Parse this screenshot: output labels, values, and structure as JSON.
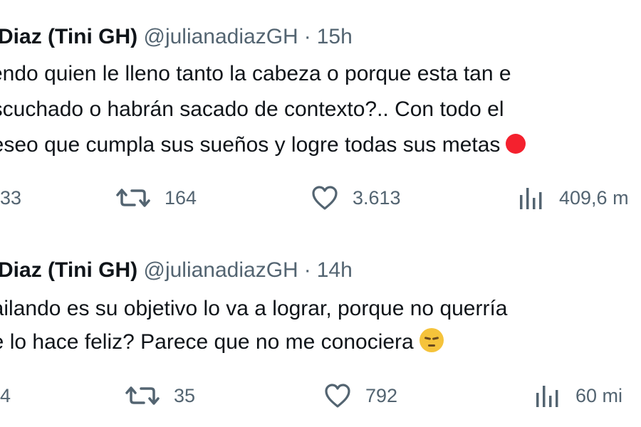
{
  "tweets": [
    {
      "name": "a Diaz (Tini GH)",
      "handle": "@julianadiazGH",
      "separator": "·",
      "time": "15h",
      "lines": [
        "tiendo quien le lleno tanto la cabeza o porque esta tan e",
        "escuchado o habrán sacado de contexto?.. Con todo el",
        "deseo que cumpla sus sueños y logre todas sus metas"
      ],
      "emoji": "red-heart-icon",
      "replies": "33",
      "retweets": "164",
      "likes": "3.613",
      "views": "409,6 m"
    },
    {
      "name": "a Diaz (Tini GH)",
      "handle": "@julianadiazGH",
      "separator": "·",
      "time": "14h",
      "lines": [
        "bailando es su objetivo lo va a lograr, porque no querría",
        "ue lo hace feliz? Parece que no me conociera"
      ],
      "emoji": "pensive-face-icon",
      "replies": "4",
      "retweets": "35",
      "likes": "792",
      "views": "60 mi"
    }
  ],
  "colors": {
    "text": "#0f1419",
    "secondary": "#536471",
    "emoji_yellow": "#f5c33b",
    "emoji_red": "#f4212e"
  }
}
